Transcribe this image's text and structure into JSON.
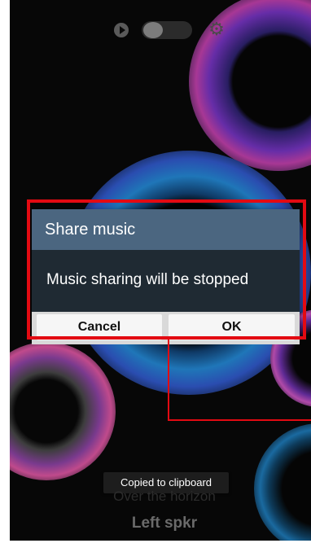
{
  "controls": {
    "play_icon": "play-icon",
    "toggle_state": "off",
    "settings_icon": "gear-icon"
  },
  "dialog": {
    "title": "Share music",
    "message": "Music sharing will be stopped",
    "cancel_label": "Cancel",
    "ok_label": "OK"
  },
  "toast": {
    "text": "Copied to clipboard"
  },
  "now_playing": {
    "title": "Over the horizon",
    "speaker": "Left spkr"
  },
  "colors": {
    "dialog_title_bg": "#4b6680",
    "dialog_body_bg": "#1f2a33",
    "highlight": "#e30a12"
  }
}
